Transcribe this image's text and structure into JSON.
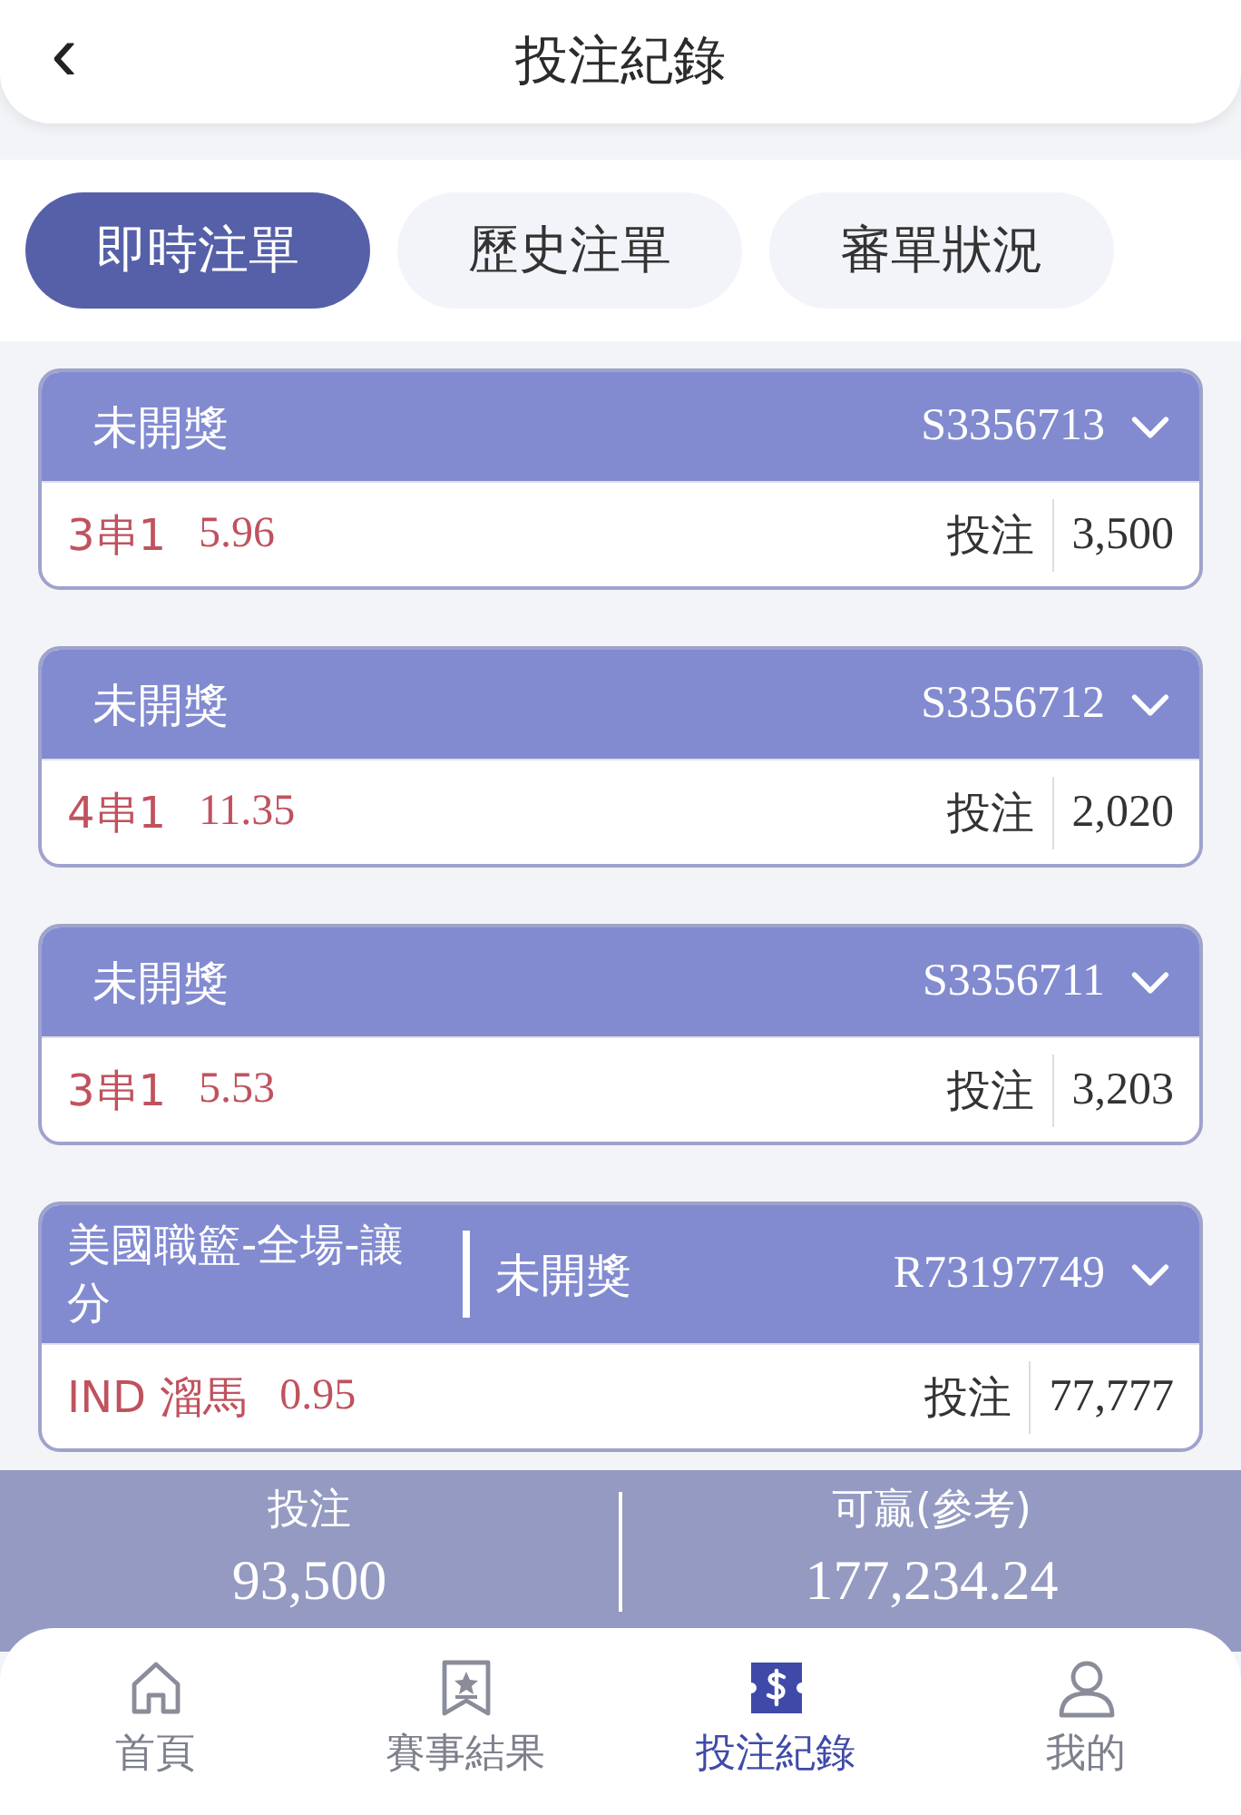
{
  "header": {
    "back_icon": "‹",
    "title": "投注紀錄"
  },
  "tabs": [
    {
      "label": "即時注單",
      "selected": true
    },
    {
      "label": "歷史注單",
      "selected": false
    },
    {
      "label": "審單狀況",
      "selected": false
    }
  ],
  "bets": [
    {
      "status": "未開獎",
      "order_id": "S3356713",
      "selection": "3串1",
      "odds": "5.96",
      "stake_label": "投注",
      "stake": "3,500"
    },
    {
      "status": "未開獎",
      "order_id": "S3356712",
      "selection": "4串1",
      "odds": "11.35",
      "stake_label": "投注",
      "stake": "2,020"
    },
    {
      "status": "未開獎",
      "order_id": "S3356711",
      "selection": "3串1",
      "odds": "5.53",
      "stake_label": "投注",
      "stake": "3,203"
    },
    {
      "market": "美國職籃-全場-讓分",
      "status": "未開獎",
      "order_id": "R73197749",
      "selection": "IND 溜馬",
      "odds": "0.95",
      "stake_label": "投注",
      "stake": "77,777"
    }
  ],
  "summary": [
    {
      "label": "投注",
      "value": "93,500"
    },
    {
      "label": "可贏(參考)",
      "value": "177,234.24"
    }
  ],
  "nav": [
    {
      "kind": "home",
      "label": "首頁",
      "selected": false
    },
    {
      "kind": "results",
      "label": "賽事結果",
      "selected": false
    },
    {
      "kind": "bets",
      "label": "投注紀錄",
      "selected": true
    },
    {
      "kind": "profile",
      "label": "我的",
      "selected": false
    }
  ]
}
